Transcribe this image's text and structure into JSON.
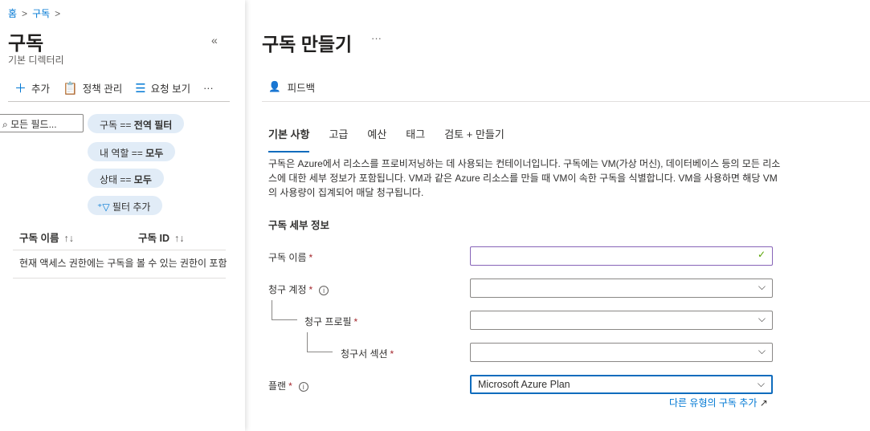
{
  "breadcrumb": [
    "홈",
    "구독"
  ],
  "left": {
    "title": "구독",
    "subtitle": "기본 디렉터리",
    "toolbar": {
      "add": "추가",
      "policy": "정책 관리",
      "requests": "요청 보기",
      "more": "···"
    },
    "search_placeholder": "모든 필드...",
    "filters": [
      {
        "key": "구독 ==",
        "value": "전역 필터"
      },
      {
        "key": "내 역할 ==",
        "value": "모두"
      },
      {
        "key": "상태 ==",
        "value": "모두"
      }
    ],
    "add_filter": "필터 추가",
    "columns": [
      "구독 이름",
      "구독 ID"
    ],
    "sort_glyph": "↑↓",
    "empty_message": "현재 액세스 권한에는 구독을 볼 수 있는 권한이 포함되어 있지 않습니다."
  },
  "right": {
    "title": "구독 만들기",
    "more": "···",
    "feedback": "피드백",
    "tabs": [
      "기본 사항",
      "고급",
      "예산",
      "태그",
      "검토 + 만들기"
    ],
    "description": "구독은 Azure에서 리소스를 프로비저닝하는 데 사용되는 컨테이너입니다. 구독에는 VM(가상 머신), 데이터베이스 등의 모든 리소스에 대한 세부 정보가 포함됩니다. VM과 같은 Azure 리소스를 만들 때 VM이 속한 구독을 식별합니다. VM을 사용하면 해당 VM의 사용량이 집계되어 매달 청구됩니다.",
    "section": "구독 세부 정보",
    "fields": {
      "name": {
        "label": "구독 이름",
        "value": ""
      },
      "billing_account": {
        "label": "청구 계정",
        "value": ""
      },
      "billing_profile": {
        "label": "청구 프로필",
        "value": ""
      },
      "invoice_section": {
        "label": "청구서 섹션",
        "value": ""
      },
      "plan": {
        "label": "플랜",
        "value": "Microsoft Azure Plan"
      }
    },
    "required_mark": "*",
    "other_link": "다른 유형의 구독 추가"
  }
}
